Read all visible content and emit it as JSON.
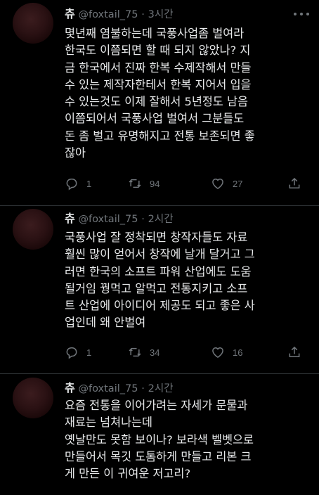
{
  "tweets": [
    {
      "name": "츄",
      "handle": "@foxtail_75",
      "separator": "·",
      "time": "3시간",
      "text": "몇년째 염불하는데 국풍사업좀 벌여라\n한국도 이쯤되면 할 때 되지 않았나? 지\n금 한국에서 진짜 한복 수제작해서 만들\n수 있는 제작자한테서 한복 지어서 입을\n수 있는것도 이제 잘해서 5년정도 남음\n이쯤되어서 국풍사업 벌여서 그분들도\n돈 좀 벌고 유명해지고 전통 보존되면 좋\n잖아",
      "replies": "1",
      "retweets": "94",
      "likes": "27"
    },
    {
      "name": "츄",
      "handle": "@foxtail_75",
      "separator": "·",
      "time": "2시간",
      "text": "국풍사업 잘 정착되면 창작자들도 자료\n훨씬 많이 얻어서 창작에 날개 달거고 그\n러면 한국의 소프트 파워 산업에도 도움\n될거임 꿩먹고 알먹고 전통지키고 소프\n트 산업에 아이디어 제공도 되고 좋은 사\n업인데 왜 안벌여",
      "replies": "1",
      "retweets": "34",
      "likes": "16"
    },
    {
      "name": "츄",
      "handle": "@foxtail_75",
      "separator": "·",
      "time": "2시간",
      "text": "요즘 전통을 이어가려는 자세가 문물과\n재료는 넘쳐나는데\n옛날만도 못함 보이나? 보라색 벨벳으로\n만들어서 목깃 도톰하게 만들고 리본 크\n게 만든 이 귀여운 저고리?"
    }
  ],
  "icons": {
    "reply": "reply-icon",
    "retweet": "retweet-icon",
    "like": "heart-icon",
    "share": "share-icon",
    "more": "more-icon"
  },
  "colors": {
    "background": "#000000",
    "text": "#e7e9ea",
    "muted": "#71767b",
    "divider": "#2f3336"
  }
}
